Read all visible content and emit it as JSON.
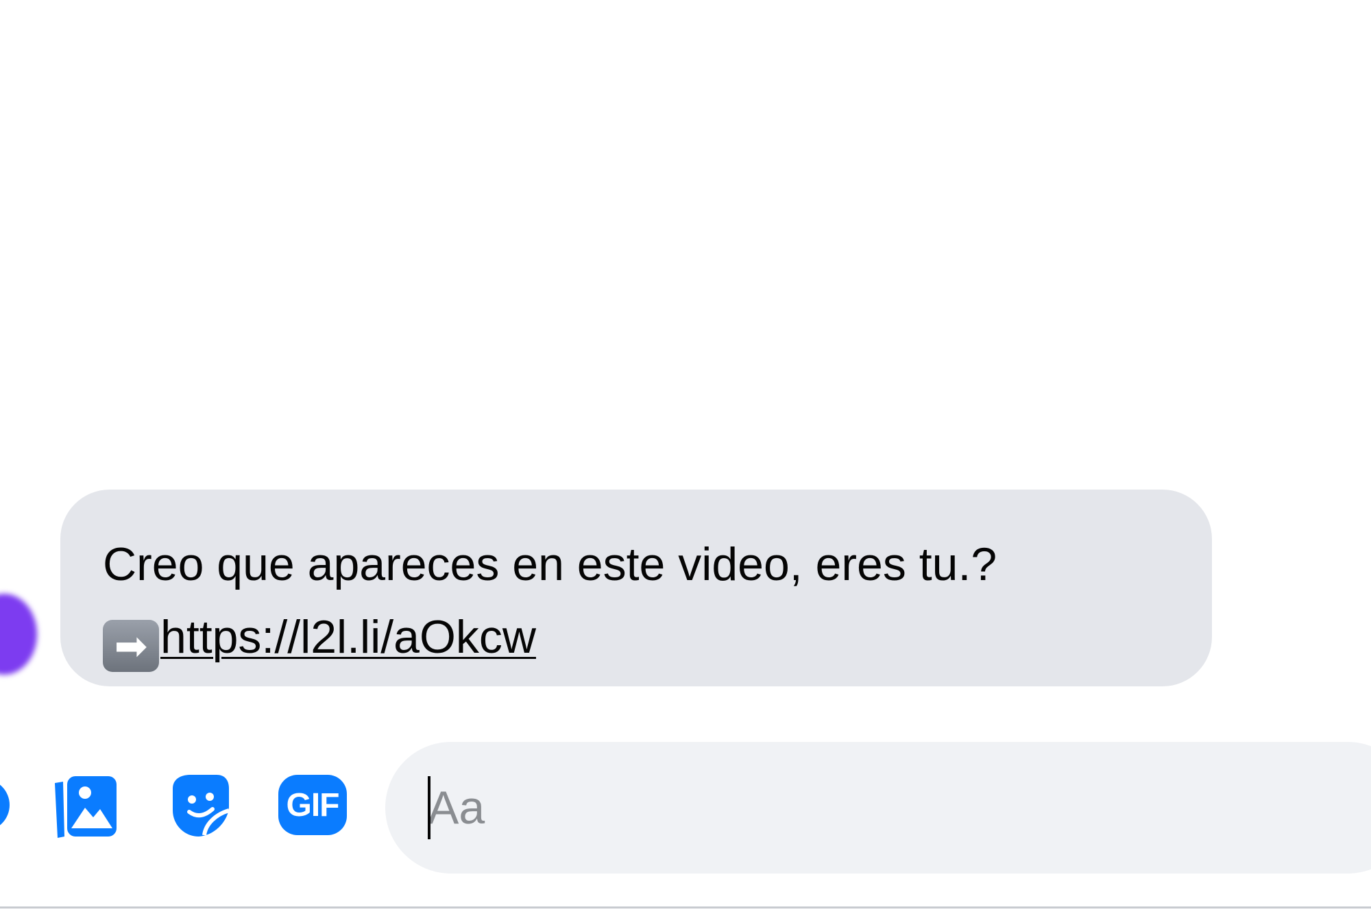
{
  "message": {
    "line1": "Creo que apareces en este video, eres tu.?",
    "arrow_emoji": "➡",
    "link_text": "https://l2l.li/aOkcw"
  },
  "composer": {
    "gif_label": "GIF",
    "input_placeholder": "Aa",
    "input_value": ""
  },
  "icons": {
    "plus": "plus-circle-icon",
    "photo": "photo-gallery-icon",
    "sticker": "sticker-icon",
    "gif": "gif-icon"
  },
  "colors": {
    "accent": "#0a7cff",
    "bubble": "#e4e6eb",
    "input_bg": "#f0f2f5",
    "avatar": "#7d3cf0",
    "placeholder": "#8a8d91"
  }
}
